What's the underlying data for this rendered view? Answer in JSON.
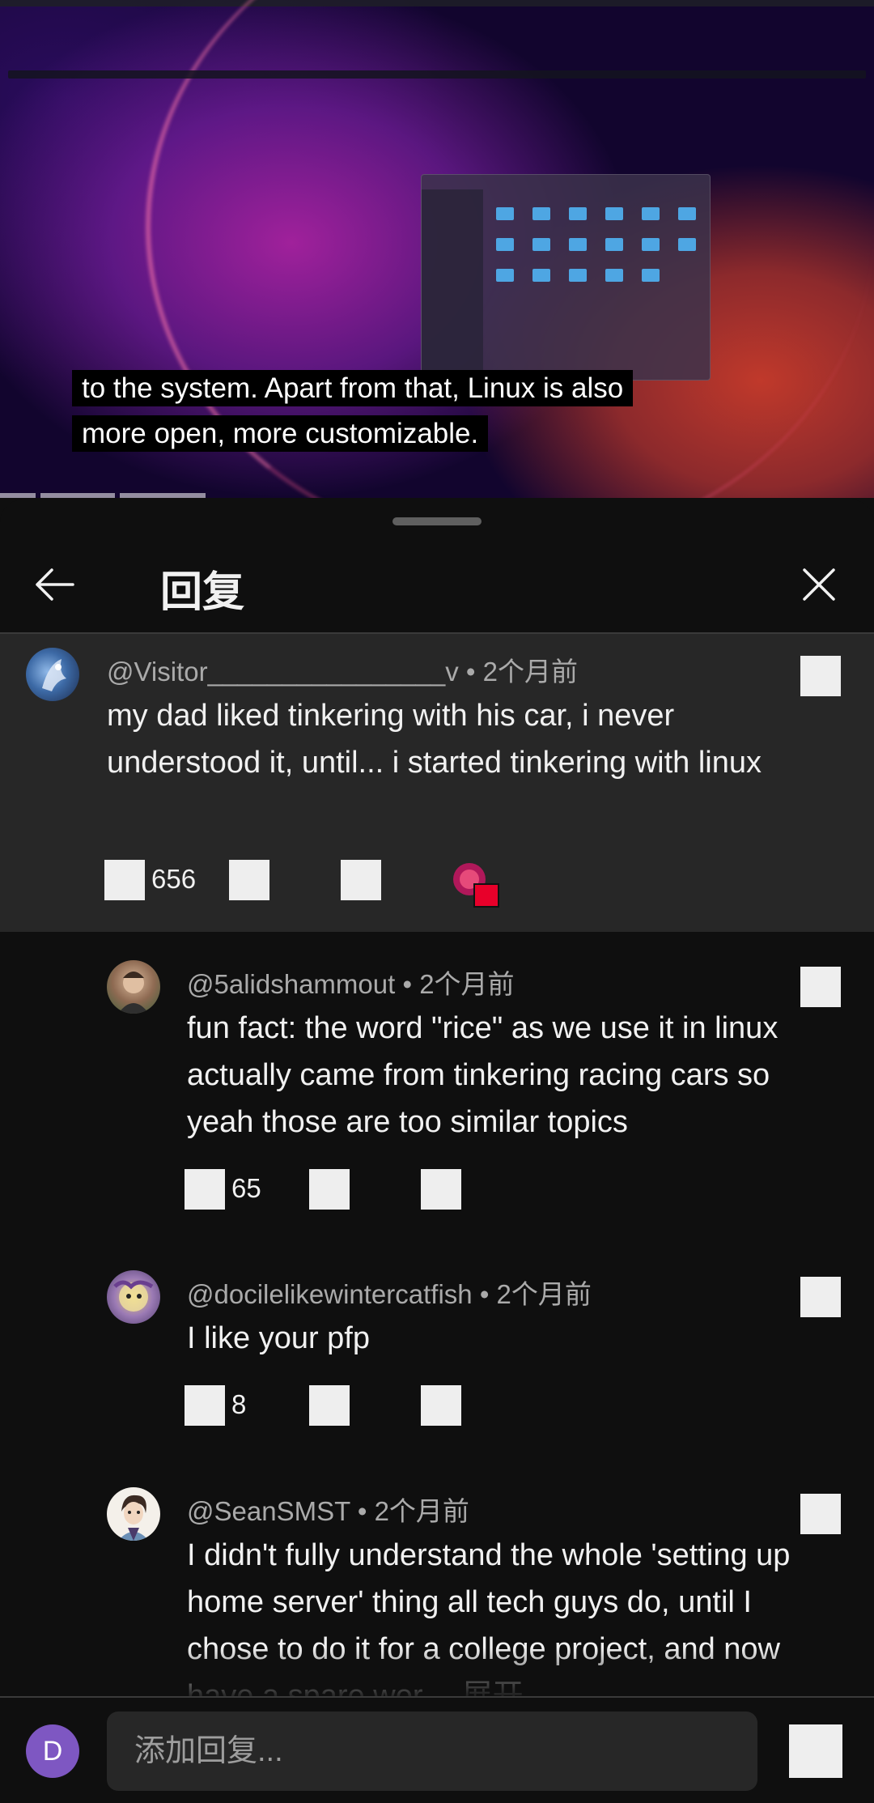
{
  "video": {
    "caption": "to the system. Apart from that, Linux is also more open, more customizable."
  },
  "panel": {
    "title": "回复"
  },
  "comments": [
    {
      "author": "@Visitor________________v",
      "time": "2个月前",
      "text": "my dad liked tinkering with his car, i never understood it, until... i started tinkering with linux",
      "likes": "656"
    },
    {
      "author": "@5alidshammout",
      "time": "2个月前",
      "text": "fun fact: the word \"rice\" as we use it in linux actually came from tinkering racing cars so yeah those are too similar topics",
      "likes": "65"
    },
    {
      "author": "@docilelikewintercatfish",
      "time": "2个月前",
      "text": "I like your pfp",
      "likes": "8"
    },
    {
      "author": "@SeanSMST",
      "time": "2个月前",
      "text": "I didn't fully understand the whole 'setting up home server' thing all tech guys do, until I chose to do it for a college project, and now have a spare wor...",
      "more": "展开"
    }
  ],
  "reply_bar": {
    "avatar_letter": "D",
    "placeholder": "添加回复..."
  },
  "colors": {
    "background": "#0f0f0f",
    "highlight": "#272727",
    "avatar_purple": "#7e57c2"
  }
}
